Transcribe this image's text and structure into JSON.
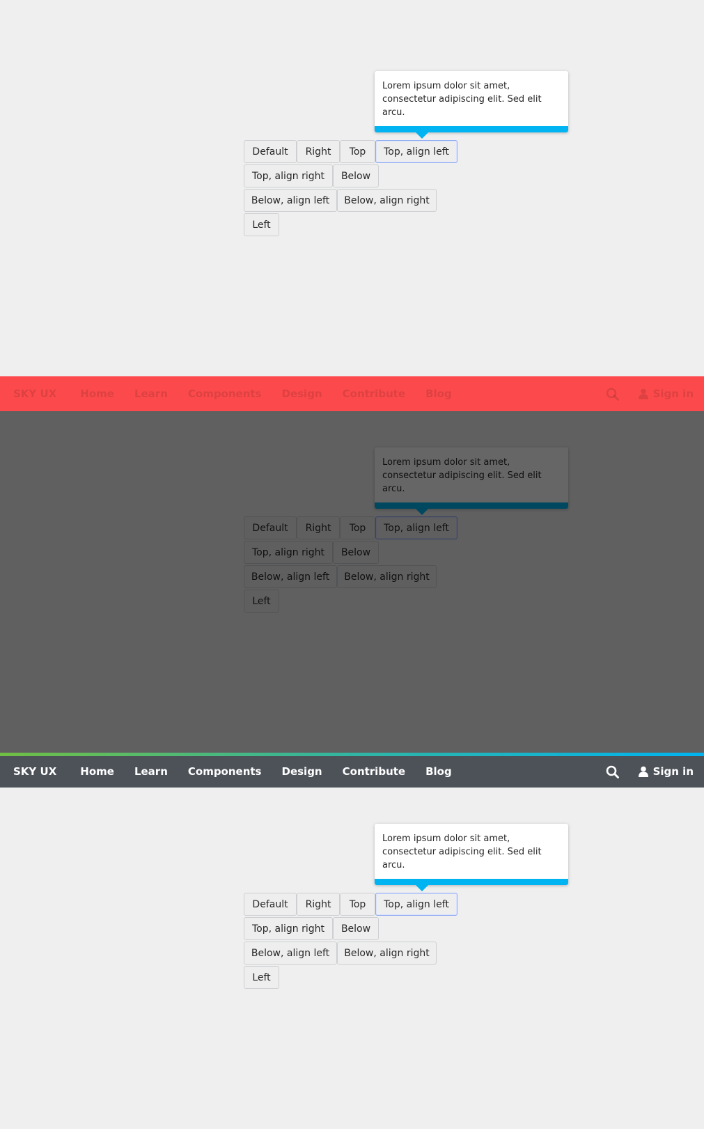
{
  "navbar": {
    "brand": "SKY UX",
    "items": [
      "Home",
      "Learn",
      "Components",
      "Design",
      "Contribute",
      "Blog"
    ],
    "search_icon": "search-icon",
    "user_icon": "user-icon",
    "sign_in": "Sign in"
  },
  "popover": {
    "text": "Lorem ipsum dolor sit amet, consectetur adipiscing elit. Sed elit arcu."
  },
  "buttons": {
    "default": "Default",
    "right": "Right",
    "top": "Top",
    "top_align_left": "Top, align left",
    "top_align_right": "Top, align right",
    "below": "Below",
    "below_align_left": "Below, align left",
    "below_align_right": "Below, align right",
    "left": "Left"
  },
  "colors": {
    "page_bg": "#efefef",
    "nav_dark": "#4d5259",
    "nav_red": "#fc4a4c",
    "accent_blue": "#00b4f1",
    "focus_border": "#8fa9f2"
  }
}
